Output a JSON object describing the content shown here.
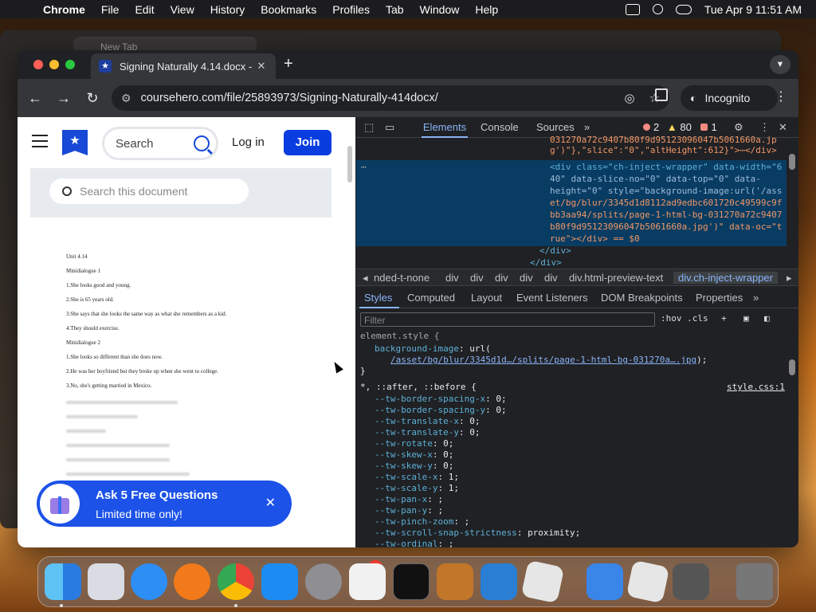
{
  "menubar": {
    "app": "Chrome",
    "items": [
      "File",
      "Edit",
      "View",
      "History",
      "Bookmarks",
      "Profiles",
      "Tab",
      "Window",
      "Help"
    ],
    "clock": "Tue Apr 9  11:51 AM"
  },
  "background_window": {
    "tab_title": "New Tab"
  },
  "browser": {
    "tab_title": "Signing Naturally 4.14.docx -",
    "url": "coursehero.com/file/25893973/Signing-Naturally-414docx/",
    "incognito_label": "Incognito"
  },
  "site": {
    "search_placeholder": "Search",
    "login_label": "Log in",
    "join_label": "Join",
    "doc_search_placeholder": "Search this document",
    "doc_lines": [
      "Unit 4.14",
      "Minidialogue 1",
      "1.She looks good and young.",
      "2.She is 65 years old.",
      "3.She says that she looks the same way as what she remembers as a kid.",
      "4.They should exercise.",
      "Minidialogue 2",
      "1.She looks so different than she does now.",
      "2.He was her boyfriend but they broke up when she went to college.",
      "3.No, she's getting married in Mexico."
    ],
    "promo": {
      "title": "Ask 5 Free Questions",
      "subtitle": "Limited time only!",
      "close": "✕"
    }
  },
  "devtools": {
    "tabs": [
      "Elements",
      "Console",
      "Sources"
    ],
    "errors": "2",
    "warnings": "80",
    "issues": "1",
    "elements_lines": [
      "031270a72c9407b80f9d95123096047b5061660a.jp",
      "g')\"},\"slice\":\"0\",\"altHeight\":612}\">⋯</div>",
      "<div class=\"ch-inject-wrapper\" data-width=\"6",
      "40\" data-slice-no=\"0\" data-top=\"0\" data-",
      "height=\"0\" style=\"background-image:url('/ass",
      "et/bg/blur/3345d1d8112ad9edbc601720c49599c9f",
      "bb3aa94/splits/page-1-html-bg-031270a72c9407",
      "b80f9d95123096047b5061660a.jpg')\" data-oc=\"t",
      "rue\"></div> == $0",
      "</div>",
      "</div>"
    ],
    "breadcrumbs": [
      "nded-t-none",
      "div",
      "div",
      "div",
      "div",
      "div",
      "div.html-preview-text",
      "div.ch-inject-wrapper"
    ],
    "style_tabs": [
      "Styles",
      "Computed",
      "Layout",
      "Event Listeners",
      "DOM Breakpoints",
      "Properties"
    ],
    "filter_placeholder": "Filter",
    "filter_tools": ":hov  .cls",
    "element_style": {
      "selector": "element.style {",
      "prop": "background-image",
      "value_prefix": ": url(",
      "url": "/asset/bg/blur/3345d1d…/splits/page-1-html-bg-031270a….jpg",
      "value_suffix": ");",
      "close": "}"
    },
    "universal_rule": {
      "selector": "*, ::after, ::before {",
      "source": "style.css:1",
      "decls": [
        [
          "--tw-border-spacing-x",
          "0;"
        ],
        [
          "--tw-border-spacing-y",
          "0;"
        ],
        [
          "--tw-translate-x",
          "0;"
        ],
        [
          "--tw-translate-y",
          "0;"
        ],
        [
          "--tw-rotate",
          "0;"
        ],
        [
          "--tw-skew-x",
          "0;"
        ],
        [
          "--tw-skew-y",
          "0;"
        ],
        [
          "--tw-scale-x",
          "1;"
        ],
        [
          "--tw-scale-y",
          "1;"
        ],
        [
          "--tw-pan-x",
          ";"
        ],
        [
          "--tw-pan-y",
          ";"
        ],
        [
          "--tw-pinch-zoom",
          ";"
        ],
        [
          "--tw-scroll-snap-strictness",
          "proximity;"
        ],
        [
          "--tw-ordinal",
          ";"
        ]
      ]
    }
  },
  "dock": {
    "apps": [
      "finder-icon",
      "launchpad-icon",
      "safari-icon",
      "firefox-icon",
      "chrome-icon",
      "app-store-icon",
      "system-settings-icon",
      "textedit-icon",
      "terminal-icon",
      "garageband-icon",
      "vscode-icon",
      "roblox-icon",
      "weather-icon",
      "roblox-studio-icon",
      "calculator-icon",
      "trash-icon"
    ],
    "settings_badge": "1"
  },
  "colors": {
    "accent": "#1849d6",
    "join": "#0a3de0",
    "devtools_bg": "#202124"
  }
}
